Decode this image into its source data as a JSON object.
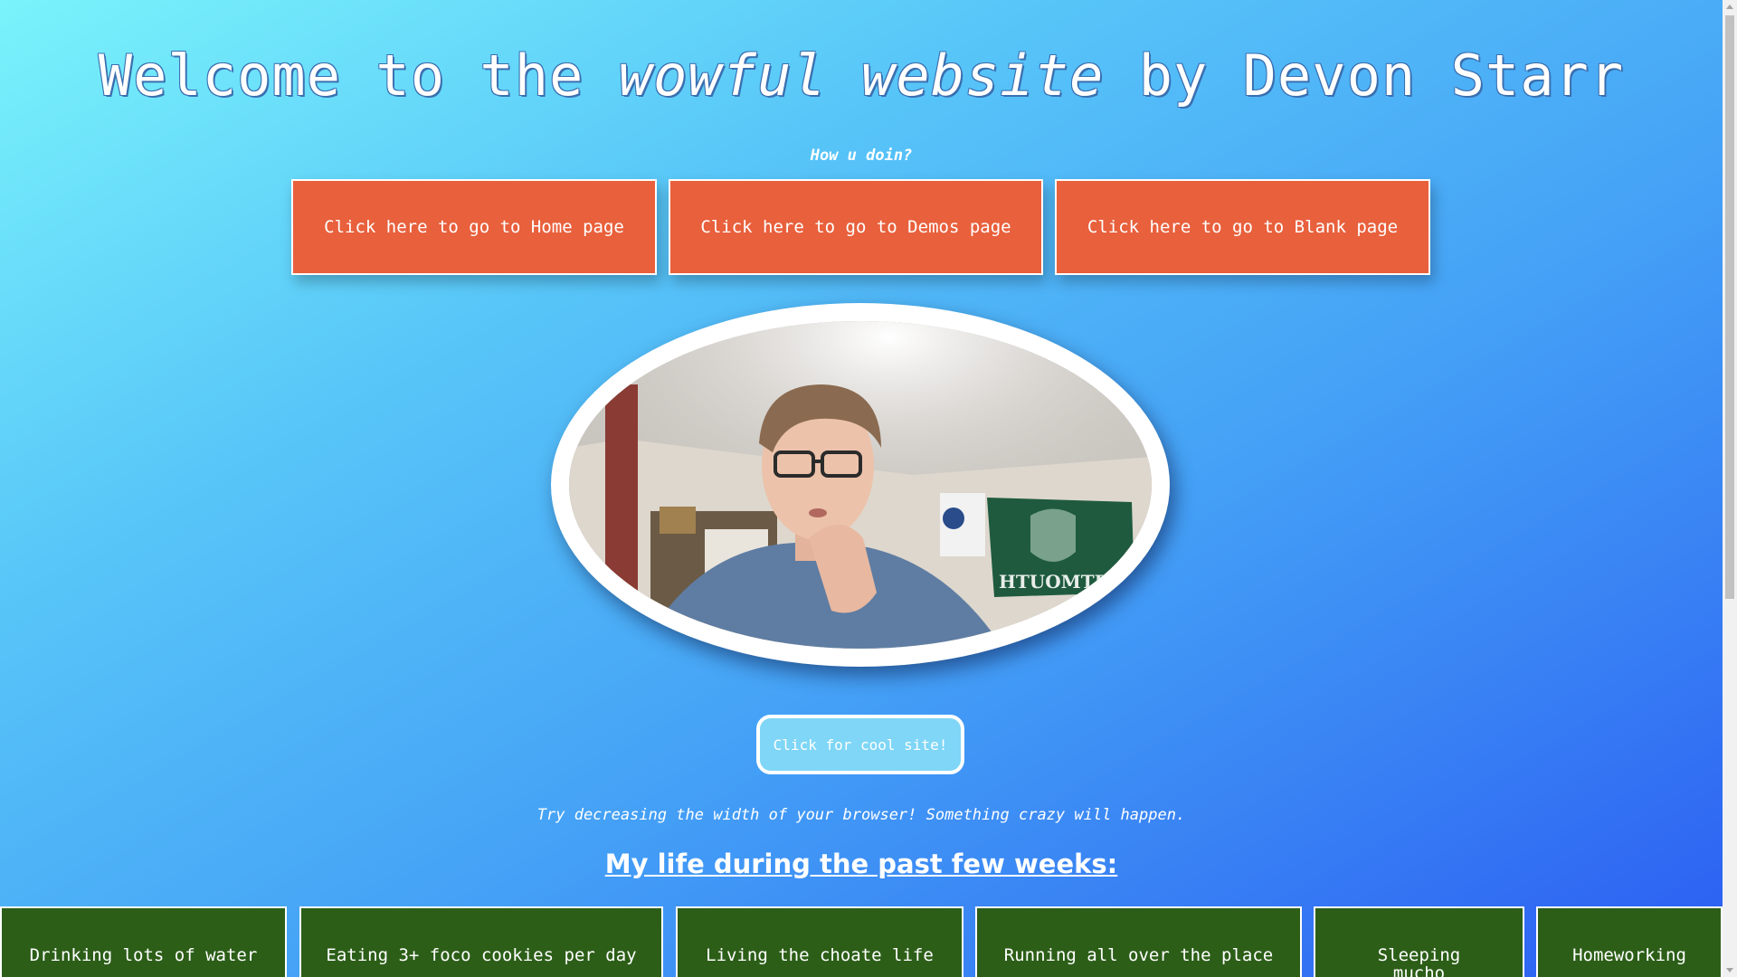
{
  "header": {
    "title_pre": "Welcome to the",
    "title_em": "wowful website",
    "title_post": "by Devon Starr",
    "subtitle": "How u doin?"
  },
  "nav": {
    "home": "Click here to go to Home page",
    "demos": "Click here to go to Demos page",
    "blank": "Click here to go to Blank page"
  },
  "photo": {
    "flag_text": "HTUOMTR"
  },
  "cool_button": "Click for cool site!",
  "tip": "Try decreasing the width of your browser! Something crazy will happen.",
  "section_heading": "My life during the past few weeks:",
  "cards": [
    "Drinking lots of water",
    "Eating 3+ foco cookies per day",
    "Living the choate life",
    "Running all over the place",
    "Sleeping mucho",
    "Homeworking"
  ],
  "colors": {
    "nav_button": "#e8603c",
    "card": "#2c5e18",
    "cool_button": "#7fd6f6"
  }
}
